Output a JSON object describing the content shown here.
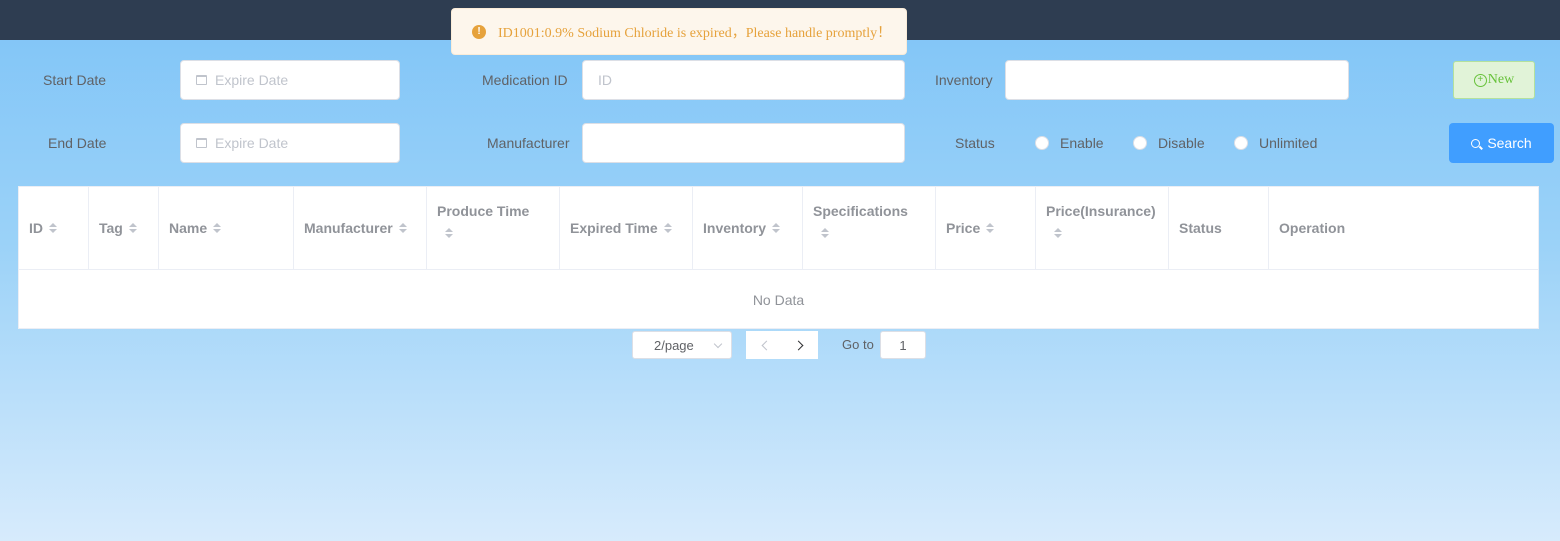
{
  "notification": {
    "icon": "warning-icon",
    "message": "ID1001:0.9% Sodium Chloride is expired，Please handle promptly！",
    "color": "#e6a23c"
  },
  "filters": {
    "start_date": {
      "label": "Start Date",
      "placeholder": "Expire Date"
    },
    "end_date": {
      "label": "End Date",
      "placeholder": "Expire Date"
    },
    "medication_id": {
      "label": "Medication ID",
      "placeholder": "ID"
    },
    "manufacturer": {
      "label": "Manufacturer",
      "placeholder": ""
    },
    "inventory": {
      "label": "Inventory",
      "placeholder": ""
    },
    "status": {
      "label": "Status",
      "options": [
        "Enable",
        "Disable",
        "Unlimited"
      ]
    }
  },
  "buttons": {
    "new_label": "New",
    "search_label": "Search",
    "accent": "#409eff"
  },
  "table": {
    "columns": [
      {
        "label": "ID",
        "sortable": true
      },
      {
        "label": "Tag",
        "sortable": true
      },
      {
        "label": "Name",
        "sortable": true
      },
      {
        "label": "Manufacturer",
        "sortable": true
      },
      {
        "label": "Produce Time",
        "sortable": true
      },
      {
        "label": "Expired Time",
        "sortable": true
      },
      {
        "label": "Inventory",
        "sortable": true
      },
      {
        "label": "Specifications",
        "sortable": true
      },
      {
        "label": "Price",
        "sortable": true
      },
      {
        "label": "Price(Insurance)",
        "sortable": true
      },
      {
        "label": "Status",
        "sortable": false
      },
      {
        "label": "Operation",
        "sortable": false
      }
    ],
    "rows": [],
    "empty_text": "No Data"
  },
  "pagination": {
    "page_size": "2/page",
    "goto_label": "Go to",
    "current_page": "1"
  }
}
